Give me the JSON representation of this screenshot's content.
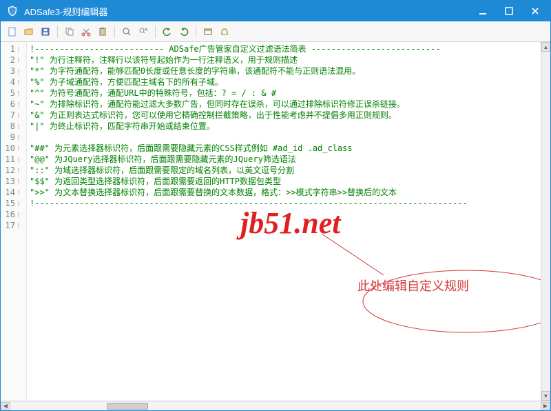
{
  "window": {
    "title": "ADSafe3-规则编辑器"
  },
  "lines": [
    "!-------------------------- ADSafe广告管家自定义过滤语法简表 --------------------------",
    "\"!\" 为行注释符，注释行以该符号起始作为一行注释语义，用于规则描述",
    "\"*\" 为字符通配符，能够匹配0长度或任意长度的字符串，该通配符不能与正则语法混用。",
    "\"%\" 为子域通配符，方便匹配主域名下的所有子域。",
    "\"^\" 为符号通配符，通配URL中的特殊符号，包括：? = / : & #",
    "\"~\" 为排除标识符，通配符能过滤大多数广告，但同时存在误杀，可以通过排除标识符修正误杀链接。",
    "\"&\" 为正则表达式标识符，您可以使用它精确控制拦截策略，出于性能考虑并不提倡多用正则规则。",
    "\"|\" 为终止标识符，匹配字符串开始或结束位置。",
    "",
    "\"##\" 为元素选择器标识符，后面跟需要隐藏元素的CSS样式例如 #ad_id .ad_class",
    "\"@@\" 为JQuery选择器标识符，后面跟需要隐藏元素的JQuery筛选语法",
    "\"::\" 为域选择器标识符，后面跟需要限定的域名列表，以英文逗号分割",
    "\"$$\" 为返回类型选择器标识符，后面跟需要返回的HTTP数据包类型",
    "\">>\" 为文本替换选择器标识符，后面跟需要替换的文本数据，格式：>>模式字符串>>替换后的文本",
    "!---------------------------------------------------------------------------------------",
    "",
    ""
  ],
  "line_numbers": [
    "1",
    "2",
    "3",
    "4",
    "5",
    "6",
    "7",
    "8",
    "9",
    "10",
    "11",
    "12",
    "13",
    "14",
    "15",
    "16",
    "17"
  ],
  "watermark": "jb51.net",
  "annotation": "此处编辑自定义规则"
}
